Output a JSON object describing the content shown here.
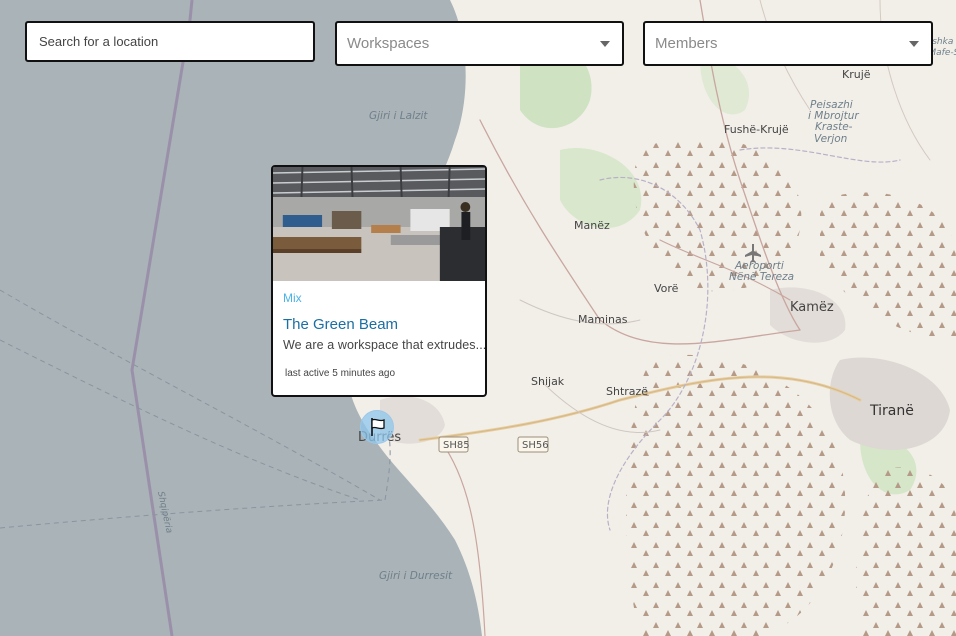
{
  "search": {
    "placeholder": "Search for a location"
  },
  "filters": {
    "workspaces": {
      "label": "Workspaces"
    },
    "members": {
      "label": "Members"
    }
  },
  "popup": {
    "category": "Mix",
    "title": "The Green Beam",
    "description": "We are a workspace that extrudes...",
    "last_active": "last active 5 minutes ago"
  },
  "map": {
    "labels": {
      "gjiri_lalzit": "Gjiri i Lalzit",
      "gjiri_durresit": "Gjiri i Durresit",
      "shqiperia": "Shqipëria",
      "fushe_kruje": "Fushë-Krujë",
      "kruje": "Krujë",
      "peisazhi1": "Peisazhi",
      "peisazhi2": "i Mbrojtur",
      "peisazhi3": "Kraste-",
      "peisazhi4": "Verjon",
      "manez": "Manëz",
      "vore": "Vorë",
      "kamez": "Kamëz",
      "maminas": "Maminas",
      "shijak": "Shijak",
      "shtraze": "Shtrazë",
      "tirane": "Tiranë",
      "durres": "Durrës",
      "sh85": "SH85",
      "sh56": "SH56",
      "aeroporti1": "Aeroporti",
      "aeroporti2": "Nënë Tereza",
      "edge1": "Bjeshka Ka",
      "edge2": "e Mafe-Si"
    }
  },
  "colors": {
    "sea": "#aab3b7",
    "land": "#f2efe9",
    "accent_link": "#1a6fa3",
    "category": "#4bb3e6",
    "marker": "#8dc6ec"
  },
  "icons": {
    "marker": "flag-icon",
    "dropdown": "chevron-down-icon"
  }
}
